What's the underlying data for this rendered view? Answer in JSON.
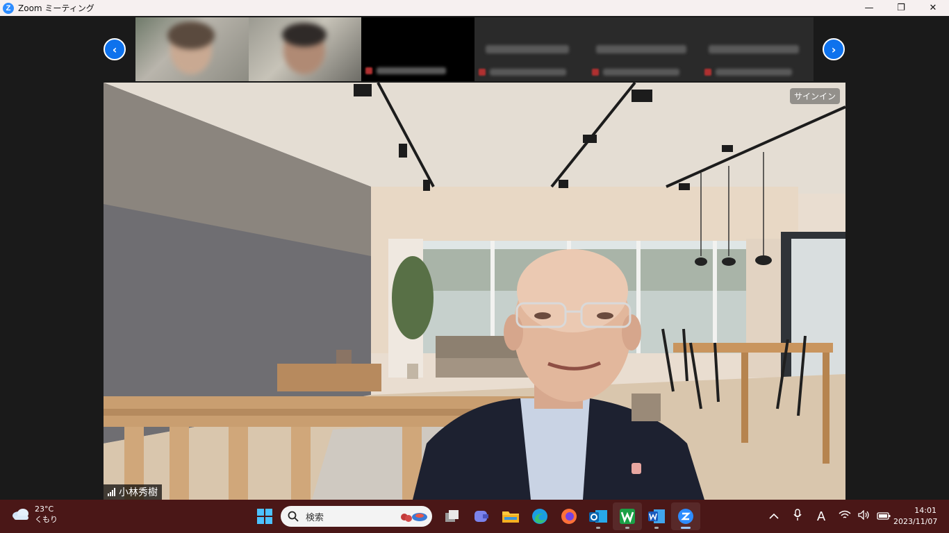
{
  "window": {
    "title": "Zoom ミーティング",
    "logo_letter": "Z",
    "controls": {
      "minimize": "—",
      "restore": "❐",
      "close": "✕"
    }
  },
  "meeting": {
    "nav_prev": "‹",
    "nav_next": "›",
    "signin_label": "サインイン",
    "active_speaker": {
      "name": "小林秀樹"
    }
  },
  "taskbar": {
    "weather": {
      "temperature": "23°C",
      "condition": "くもり"
    },
    "search_placeholder": "検索",
    "apps": [
      "start-icon",
      "search",
      "task-view-icon",
      "teams-icon",
      "file-explorer-icon",
      "edge-icon",
      "firefox-icon",
      "outlook-icon",
      "wps-icon",
      "word-icon",
      "zoom-icon"
    ],
    "tray": {
      "ime_label": "A"
    },
    "clock": {
      "time": "14:01",
      "date": "2023/11/07"
    }
  },
  "colors": {
    "accent": "#0e72ed",
    "taskbar": "#4a1717",
    "titlebar": "#f6f0f0"
  }
}
